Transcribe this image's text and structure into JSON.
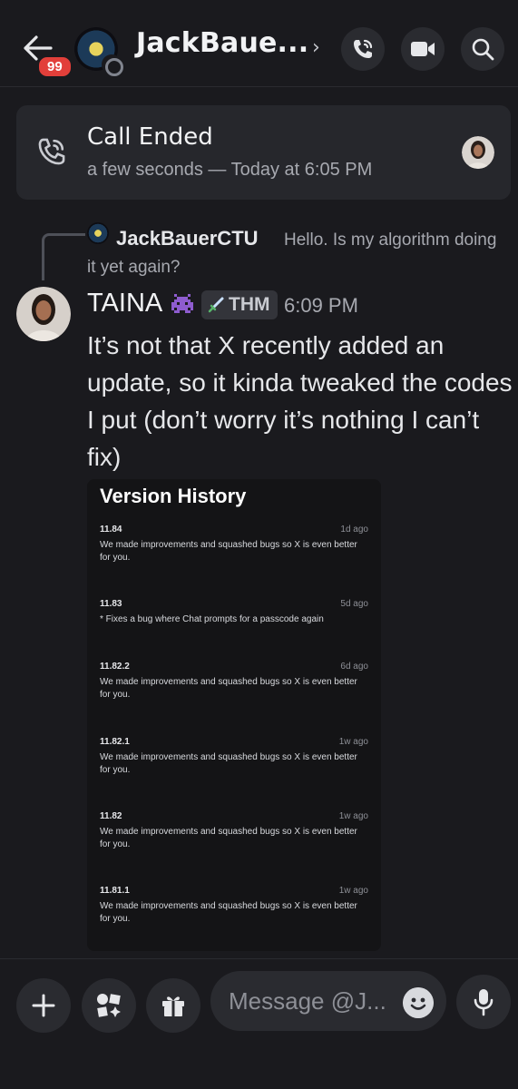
{
  "header": {
    "unread_badge": "99",
    "title": "JackBaue...",
    "chevron": "›",
    "icons": [
      "back-arrow-icon",
      "voice-call-icon",
      "video-call-icon",
      "search-icon"
    ]
  },
  "call_card": {
    "title": "Call Ended",
    "subtitle": "a few seconds — Today at 6:05 PM"
  },
  "reply": {
    "author": "JackBauerCTU",
    "text_line1": "Hello.  Is my algorithm doing",
    "text_line2": "it yet again?"
  },
  "message": {
    "author": "TAINA",
    "tag": "THM",
    "time": "6:09 PM",
    "body": "It’s not that X recently added an update, so it kinda tweaked the codes I put (don’t worry it’s nothing I can’t fix)"
  },
  "attachment": {
    "title": "Version History",
    "entries": [
      {
        "version": "11.84",
        "ago": "1d ago",
        "note": "We made improvements and squashed bugs so X is even better for you."
      },
      {
        "version": "11.83",
        "ago": "5d ago",
        "note": "* Fixes a bug where Chat prompts for a passcode again"
      },
      {
        "version": "11.82.2",
        "ago": "6d ago",
        "note": "We made improvements and squashed bugs so X is even better for you."
      },
      {
        "version": "11.82.1",
        "ago": "1w ago",
        "note": "We made improvements and squashed bugs so X is even better for you."
      },
      {
        "version": "11.82",
        "ago": "1w ago",
        "note": "We made improvements and squashed bugs so X is even better for you."
      },
      {
        "version": "11.81.1",
        "ago": "1w ago",
        "note": "We made improvements and squashed bugs so X is even better for you."
      }
    ]
  },
  "composer": {
    "placeholder": "Message @J..."
  },
  "colors": {
    "background": "#1a1a1e",
    "card": "#26272c",
    "badge": "#e23f3a",
    "muted_text": "#a7a9b0"
  }
}
